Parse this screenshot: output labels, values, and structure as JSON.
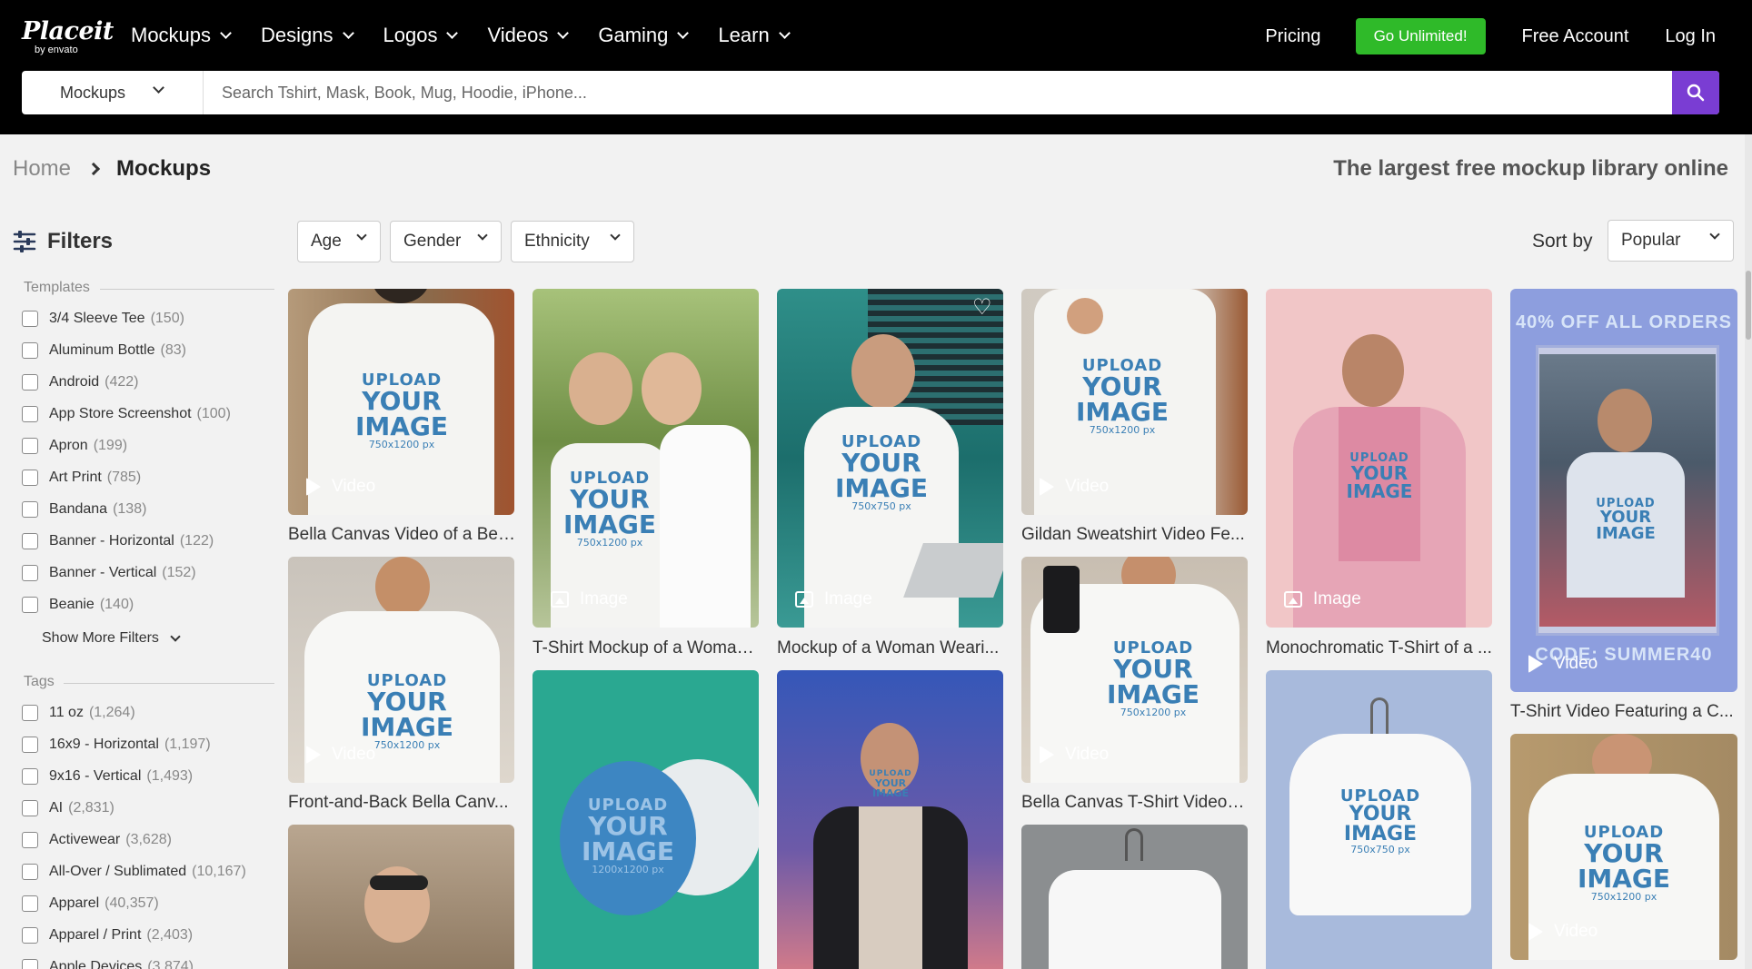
{
  "header": {
    "logo": "Placeit",
    "logo_sub": "by envato",
    "nav": [
      "Mockups",
      "Designs",
      "Logos",
      "Videos",
      "Gaming",
      "Learn"
    ],
    "pricing": "Pricing",
    "go_unlimited": "Go Unlimited!",
    "free_account": "Free Account",
    "log_in": "Log In",
    "accent_color": "#2fba29",
    "search_button_color": "#7a3dd3"
  },
  "search": {
    "category": "Mockups",
    "placeholder": "Search Tshirt, Mask, Book, Mug, Hoodie, iPhone..."
  },
  "breadcrumb": {
    "home": "Home",
    "current": "Mockups"
  },
  "tagline": "The largest free mockup library online",
  "sidebar": {
    "title": "Filters",
    "templates_label": "Templates",
    "templates": [
      {
        "label": "3/4 Sleeve Tee",
        "count": "(150)"
      },
      {
        "label": "Aluminum Bottle",
        "count": "(83)"
      },
      {
        "label": "Android",
        "count": "(422)"
      },
      {
        "label": "App Store Screenshot",
        "count": "(100)"
      },
      {
        "label": "Apron",
        "count": "(199)"
      },
      {
        "label": "Art Print",
        "count": "(785)"
      },
      {
        "label": "Bandana",
        "count": "(138)"
      },
      {
        "label": "Banner - Horizontal",
        "count": "(122)"
      },
      {
        "label": "Banner - Vertical",
        "count": "(152)"
      },
      {
        "label": "Beanie",
        "count": "(140)"
      }
    ],
    "show_more": "Show More Filters",
    "tags_label": "Tags",
    "tags": [
      {
        "label": "11 oz",
        "count": "(1,264)"
      },
      {
        "label": "16x9 - Horizontal",
        "count": "(1,197)"
      },
      {
        "label": "9x16 - Vertical",
        "count": "(1,493)"
      },
      {
        "label": "AI",
        "count": "(2,831)"
      },
      {
        "label": "Activewear",
        "count": "(3,628)"
      },
      {
        "label": "All-Over / Sublimated",
        "count": "(10,167)"
      },
      {
        "label": "Apparel",
        "count": "(40,357)"
      },
      {
        "label": "Apparel / Print",
        "count": "(2,403)"
      },
      {
        "label": "Apple Devices",
        "count": "(3,874)"
      }
    ]
  },
  "filters": {
    "age": "Age",
    "gender": "Gender",
    "ethnicity": "Ethnicity",
    "sort_label": "Sort by",
    "sort_value": "Popular"
  },
  "upload_text": {
    "line1": "UPLOAD",
    "line2": "YOUR",
    "line3": "IMAGE",
    "size_a": "750x1200 px",
    "size_b": "750x750 px",
    "size_c": "1200x1200 px"
  },
  "badges": {
    "video": "Video",
    "image": "Image"
  },
  "promo": {
    "top": "40% OFF ALL ORDERS",
    "code": "CODE: SUMMER40"
  },
  "captions": {
    "c1": "Bella Canvas Video of a Bea...",
    "c2": "Front-and-Back Bella Canv...",
    "c3": "T-Shirt Mockup of a Woman...",
    "c4": "Mockup of a Woman Weari...",
    "c5": "Gildan Sweatshirt Video Fe...",
    "c6": "Bella Canvas T-Shirt Video F...",
    "c7": "Monochromatic T-Shirt of a ...",
    "c8": "T-Shirt Video Featuring a C..."
  }
}
